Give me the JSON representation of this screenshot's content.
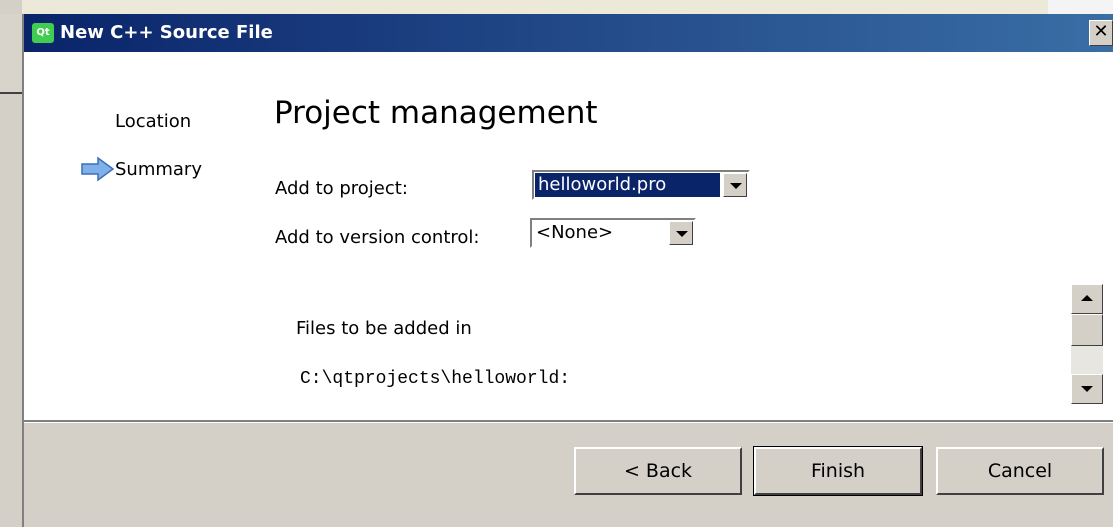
{
  "dialog": {
    "title": "New C++ Source File",
    "close_glyph": "✕",
    "icon_text": "Qt"
  },
  "nav": {
    "items": [
      {
        "label": "Location",
        "current": false
      },
      {
        "label": "Summary",
        "current": true
      }
    ]
  },
  "page": {
    "title": "Project management",
    "add_to_project_label": "Add to project:",
    "add_to_project_value": "helloworld.pro",
    "add_to_vc_label": "Add to version control:",
    "add_to_vc_value": "<None>",
    "files_label": "Files to be added in",
    "files_path": "C:\\qtprojects\\helloworld:"
  },
  "buttons": {
    "back": "< Back",
    "finish": "Finish",
    "cancel": "Cancel"
  },
  "colors": {
    "titlebar": "#0a246a",
    "selection": "#0a246a",
    "face": "#d4d0c8",
    "arrow": "#5b8fd6"
  }
}
